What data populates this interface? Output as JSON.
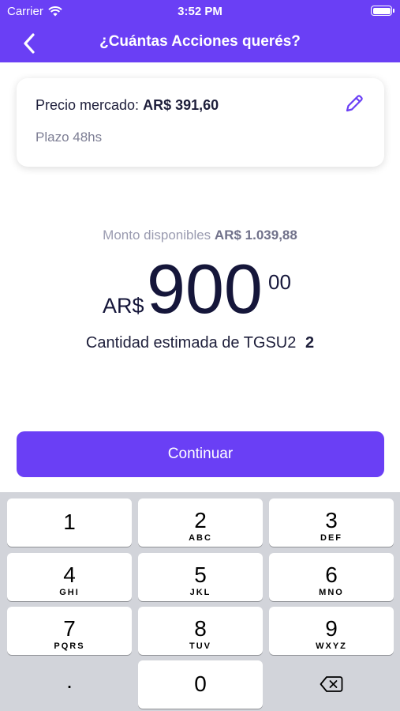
{
  "status_bar": {
    "carrier": "Carrier",
    "time": "3:52 PM"
  },
  "header": {
    "title": "¿Cuántas Acciones querés?"
  },
  "market_card": {
    "price_label": "Precio mercado:",
    "price_value": "AR$ 391,60",
    "term": "Plazo 48hs"
  },
  "available": {
    "label": "Monto disponibles",
    "value": "AR$ 1.039,88"
  },
  "amount": {
    "currency": "AR$",
    "integer": "900",
    "cents": "00"
  },
  "estimate": {
    "label": "Cantidad estimada de TGSU2",
    "value": "2"
  },
  "continue_label": "Continuar",
  "keypad": {
    "keys": [
      {
        "num": "1",
        "letters": ""
      },
      {
        "num": "2",
        "letters": "ABC"
      },
      {
        "num": "3",
        "letters": "DEF"
      },
      {
        "num": "4",
        "letters": "GHI"
      },
      {
        "num": "5",
        "letters": "JKL"
      },
      {
        "num": "6",
        "letters": "MNO"
      },
      {
        "num": "7",
        "letters": "PQRS"
      },
      {
        "num": "8",
        "letters": "TUV"
      },
      {
        "num": "9",
        "letters": "WXYZ"
      }
    ],
    "decimal": ".",
    "zero": "0"
  },
  "colors": {
    "accent": "#6a3ff5",
    "text_dark": "#15163a",
    "keyboard_bg": "#d2d4da"
  }
}
